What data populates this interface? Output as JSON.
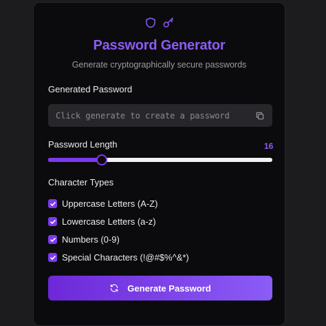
{
  "header": {
    "title": "Password Generator",
    "subtitle": "Generate cryptographically secure passwords",
    "icons": [
      "shield-icon",
      "key-icon"
    ]
  },
  "password": {
    "label": "Generated Password",
    "value": "",
    "placeholder": "Click generate to create a password",
    "copy_icon": "copy-icon"
  },
  "length": {
    "label": "Password Length",
    "value": "16",
    "fraction": 0.24
  },
  "character_types": {
    "label": "Character Types",
    "options": [
      {
        "label": "Uppercase Letters (A-Z)",
        "checked": true
      },
      {
        "label": "Lowercase Letters (a-z)",
        "checked": true
      },
      {
        "label": "Numbers (0-9)",
        "checked": true
      },
      {
        "label": "Special Characters (!@#$%^&*)",
        "checked": true
      }
    ]
  },
  "generate_button": {
    "label": "Generate Password",
    "icon": "refresh-icon"
  },
  "colors": {
    "accent": "#8b5cf6",
    "accent_dark": "#7c3aed",
    "background": "#0b0b0d",
    "input_bg": "#26262b"
  }
}
